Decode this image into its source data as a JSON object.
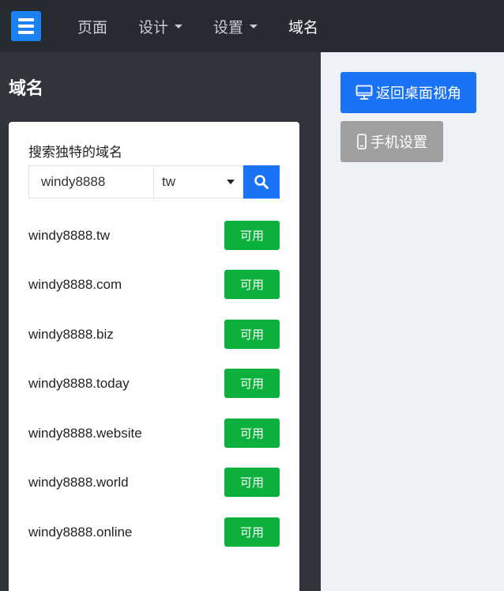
{
  "topbar": {
    "logo_icon": "menu-logo-icon",
    "nav": [
      {
        "label": "页面",
        "has_dropdown": false
      },
      {
        "label": "设计",
        "has_dropdown": true
      },
      {
        "label": "设置",
        "has_dropdown": true
      },
      {
        "label": "域名",
        "has_dropdown": false,
        "active": true
      }
    ]
  },
  "sidebar": {
    "title": "域名",
    "search": {
      "label": "搜索独特的域名",
      "query": "windy8888",
      "tld": "tw",
      "button_icon": "search-icon"
    },
    "results": [
      {
        "domain": "windy8888.tw",
        "status": "可用"
      },
      {
        "domain": "windy8888.com",
        "status": "可用"
      },
      {
        "domain": "windy8888.biz",
        "status": "可用"
      },
      {
        "domain": "windy8888.today",
        "status": "可用"
      },
      {
        "domain": "windy8888.website",
        "status": "可用"
      },
      {
        "domain": "windy8888.world",
        "status": "可用"
      },
      {
        "domain": "windy8888.online",
        "status": "可用"
      }
    ]
  },
  "preview": {
    "desktop_button": {
      "label": "返回桌面视角",
      "icon": "monitor-icon"
    },
    "mobile_button": {
      "label": "手机设置",
      "icon": "mobile-phone-icon"
    }
  },
  "colors": {
    "topbar_bg": "#252b31",
    "sidebar_bg": "#2f353b",
    "accent_blue": "#1a73f5",
    "available_green": "#0cb03c",
    "mobile_btn_gray": "#a0a0a0"
  }
}
